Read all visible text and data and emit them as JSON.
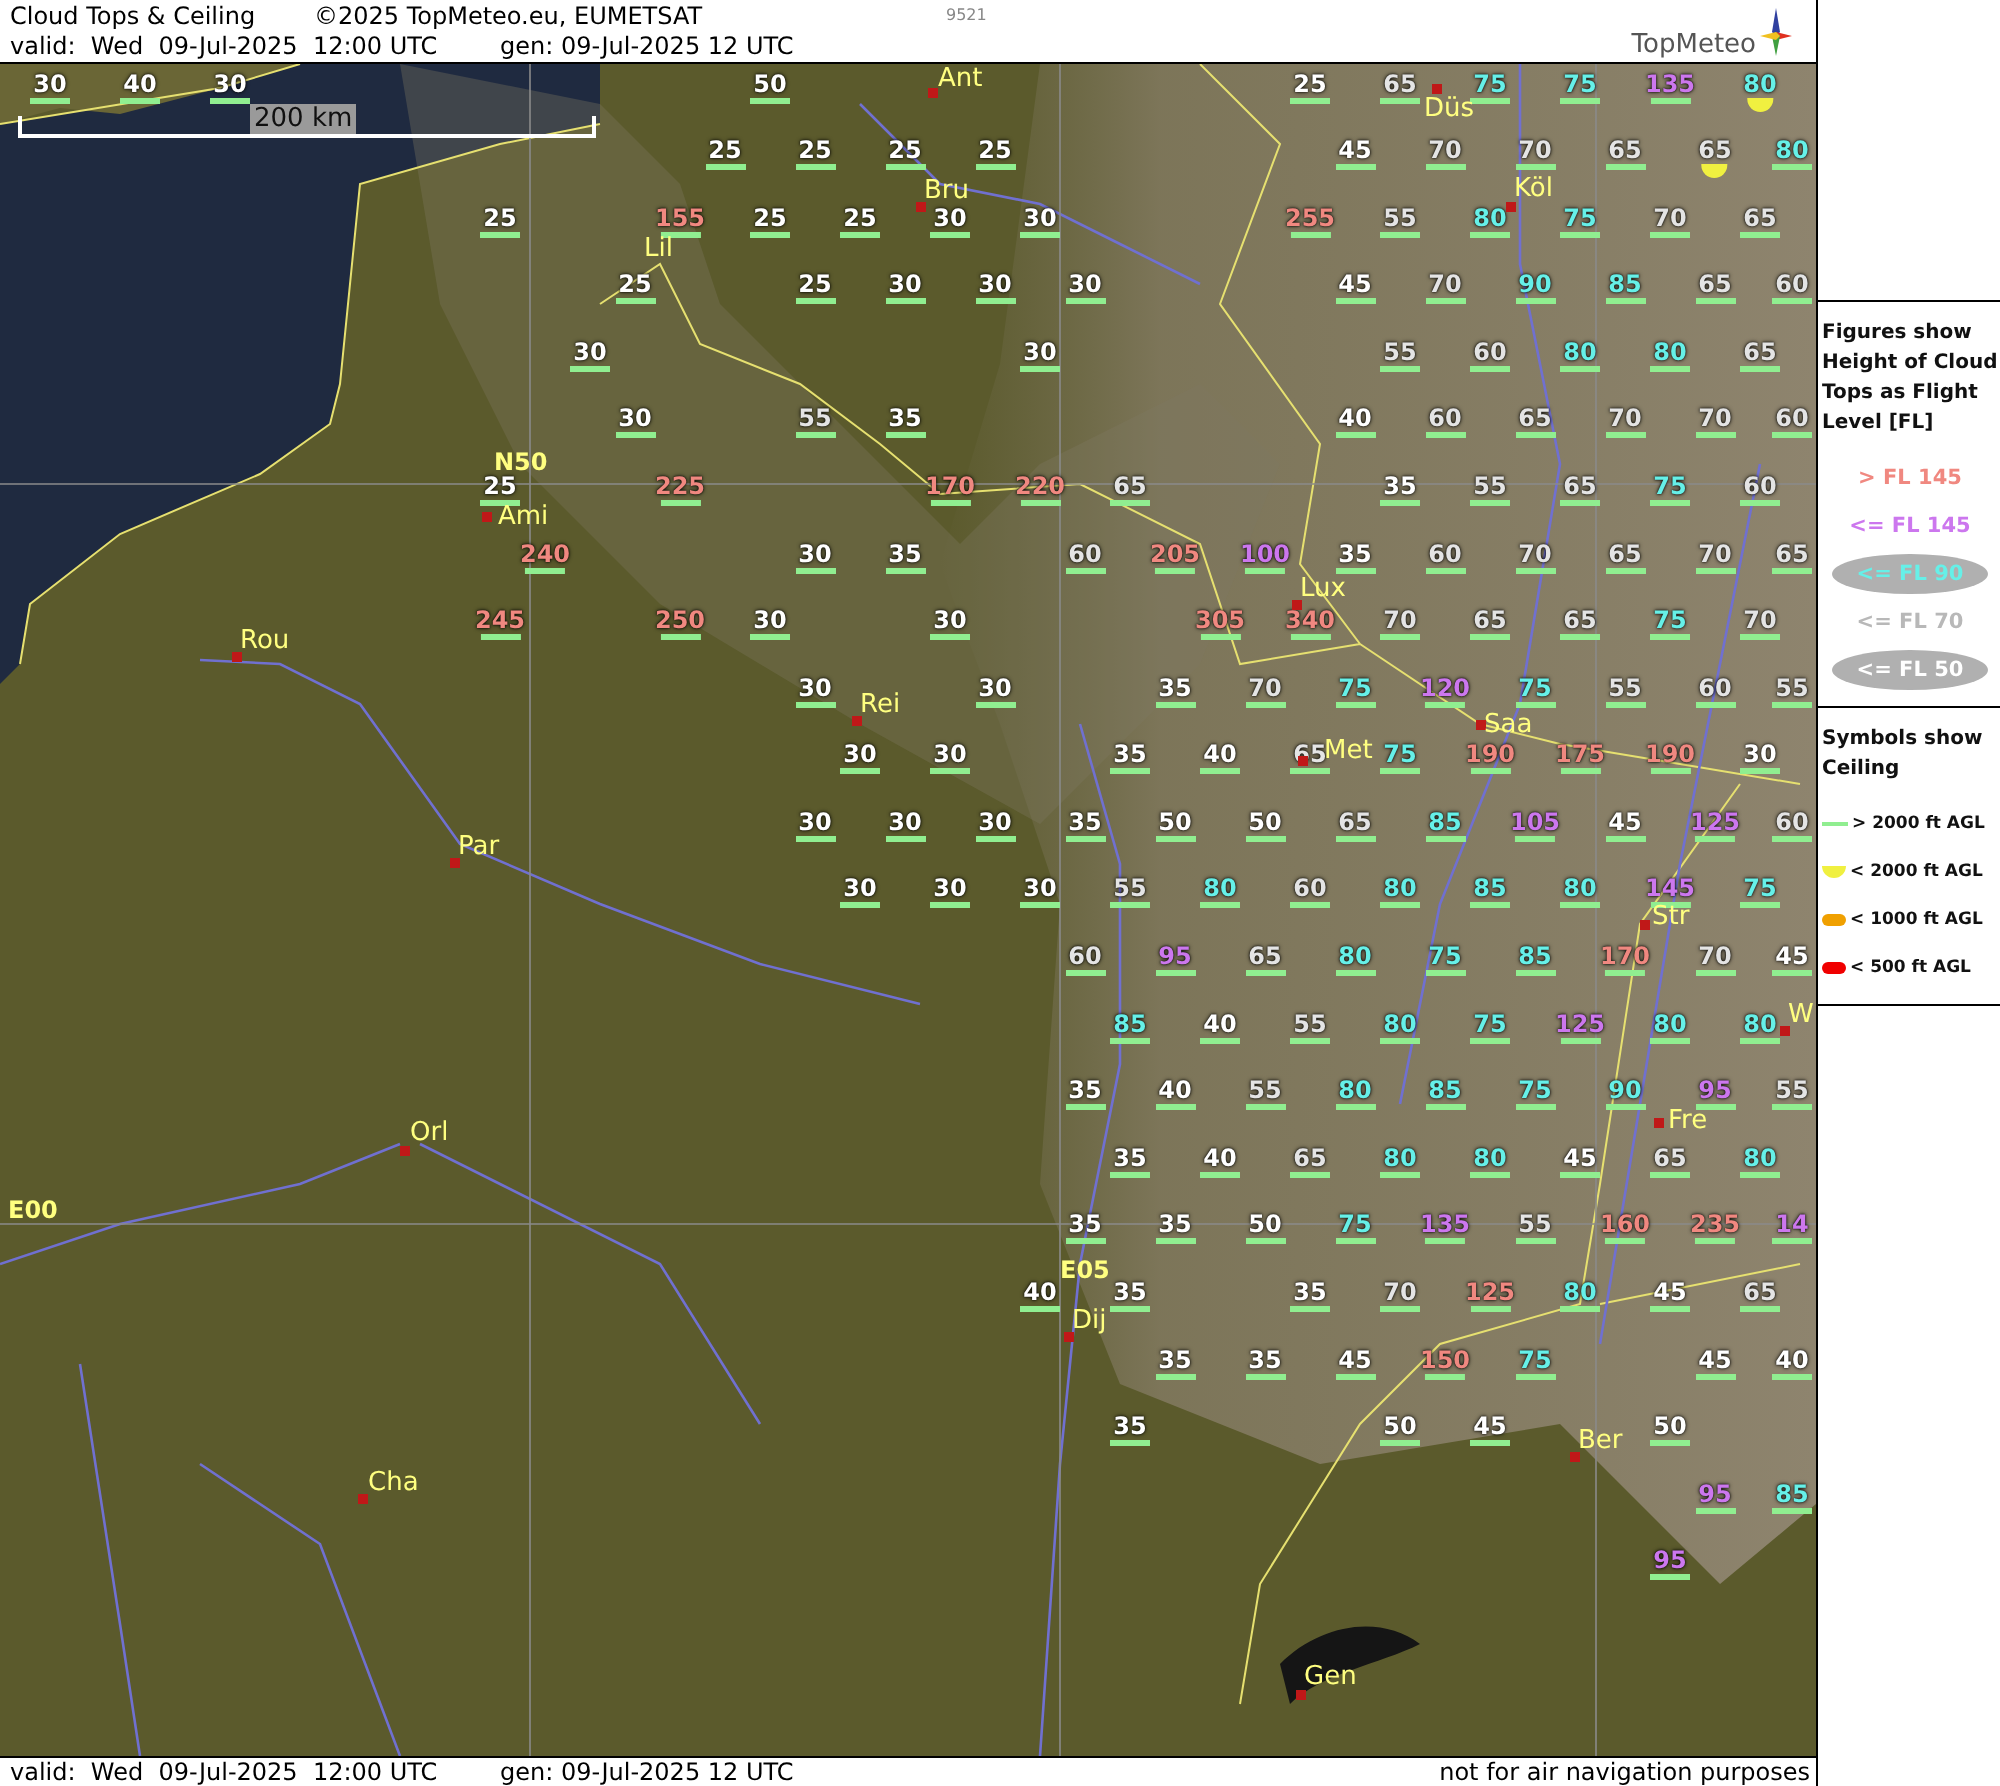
{
  "header": {
    "title": "Cloud Tops & Ceiling",
    "copyright": "©2025 TopMeteo.eu, EUMETSAT",
    "code": "9521",
    "valid": "valid:  Wed  09-Jul-2025  12:00 UTC",
    "generated": "gen: 09-Jul-2025 12 UTC",
    "logo": "TopMeteo"
  },
  "map": {
    "scale": "200 km",
    "grid_labels": [
      "N50",
      "E00",
      "E05"
    ],
    "cities": [
      {
        "name": "Düs",
        "marker": true
      },
      {
        "name": "Ant",
        "marker": true
      },
      {
        "name": "Bru",
        "marker": true
      },
      {
        "name": "Köl",
        "marker": true
      },
      {
        "name": "Lil",
        "marker": false
      },
      {
        "name": "Ami",
        "marker": true
      },
      {
        "name": "Lux",
        "marker": true
      },
      {
        "name": "Rou",
        "marker": true
      },
      {
        "name": "Rei",
        "marker": true
      },
      {
        "name": "Saa",
        "marker": true
      },
      {
        "name": "Met",
        "marker": true
      },
      {
        "name": "Par",
        "marker": true
      },
      {
        "name": "Str",
        "marker": true
      },
      {
        "name": "W",
        "marker": true
      },
      {
        "name": "Fre",
        "marker": true
      },
      {
        "name": "Orl",
        "marker": true
      },
      {
        "name": "Dij",
        "marker": true
      },
      {
        "name": "Ber",
        "marker": true
      },
      {
        "name": "Cha",
        "marker": true
      },
      {
        "name": "Gen",
        "marker": true
      }
    ],
    "rows": [
      {
        "cells": [
          {
            "value": "30",
            "color": "#ffffff",
            "low_ceiling": false
          },
          {
            "value": "40",
            "color": "#ffffff",
            "low_ceiling": false
          },
          {
            "value": "30",
            "color": "#ffffff",
            "low_ceiling": false
          },
          null,
          null,
          null,
          null,
          null,
          {
            "value": "50",
            "color": "#ffffff",
            "low_ceiling": false
          },
          null,
          null,
          null,
          null,
          null,
          {
            "value": "25",
            "color": "#ffffff",
            "low_ceiling": false
          },
          {
            "value": "65",
            "color": "#e4e4e4",
            "low_ceiling": false
          },
          {
            "value": "75",
            "color": "#66f0e8",
            "low_ceiling": false
          },
          {
            "value": "75",
            "color": "#66f0e8",
            "low_ceiling": false
          },
          {
            "value": "135",
            "color": "#cc77ee",
            "low_ceiling": false
          },
          {
            "value": "80",
            "color": "#66f0e8",
            "low_ceiling": true
          }
        ]
      },
      {
        "cells": [
          null,
          null,
          null,
          null,
          null,
          null,
          null,
          {
            "value": "25",
            "color": "#ffffff",
            "low_ceiling": false
          },
          {
            "value": "25",
            "color": "#ffffff",
            "low_ceiling": false
          },
          {
            "value": "25",
            "color": "#ffffff",
            "low_ceiling": false
          },
          {
            "value": "25",
            "color": "#ffffff",
            "low_ceiling": false
          },
          null,
          null,
          null,
          {
            "value": "45",
            "color": "#ffffff",
            "low_ceiling": false
          },
          {
            "value": "70",
            "color": "#e4e4e4",
            "low_ceiling": false
          },
          {
            "value": "70",
            "color": "#e4e4e4",
            "low_ceiling": false
          },
          {
            "value": "65",
            "color": "#e4e4e4",
            "low_ceiling": false
          },
          {
            "value": "65",
            "color": "#e4e4e4",
            "low_ceiling": true
          },
          {
            "value": "80",
            "color": "#66f0e8",
            "low_ceiling": false
          }
        ]
      },
      {
        "cells": [
          null,
          null,
          null,
          null,
          null,
          {
            "value": "25",
            "color": "#ffffff",
            "low_ceiling": false
          },
          null,
          {
            "value": "155",
            "color": "#f08880",
            "low_ceiling": false
          },
          {
            "value": "25",
            "color": "#ffffff",
            "low_ceiling": false
          },
          {
            "value": "25",
            "color": "#ffffff",
            "low_ceiling": false
          },
          {
            "value": "30",
            "color": "#ffffff",
            "low_ceiling": false
          },
          {
            "value": "30",
            "color": "#ffffff",
            "low_ceiling": false
          },
          null,
          null,
          {
            "value": "255",
            "color": "#f08880",
            "low_ceiling": false
          },
          {
            "value": "55",
            "color": "#e4e4e4",
            "low_ceiling": false
          },
          {
            "value": "80",
            "color": "#66f0e8",
            "low_ceiling": false
          },
          {
            "value": "75",
            "color": "#66f0e8",
            "low_ceiling": false
          },
          {
            "value": "70",
            "color": "#e4e4e4",
            "low_ceiling": false
          },
          {
            "value": "65",
            "color": "#e4e4e4",
            "low_ceiling": false
          }
        ]
      },
      {
        "cells": [
          null,
          null,
          null,
          null,
          null,
          null,
          {
            "value": "25",
            "color": "#ffffff",
            "low_ceiling": false
          },
          null,
          {
            "value": "25",
            "color": "#ffffff",
            "low_ceiling": false
          },
          {
            "value": "30",
            "color": "#ffffff",
            "low_ceiling": false
          },
          {
            "value": "30",
            "color": "#ffffff",
            "low_ceiling": false
          },
          {
            "value": "30",
            "color": "#ffffff",
            "low_ceiling": false
          },
          null,
          null,
          {
            "value": "45",
            "color": "#ffffff",
            "low_ceiling": false
          },
          {
            "value": "70",
            "color": "#e4e4e4",
            "low_ceiling": false
          },
          {
            "value": "90",
            "color": "#66f0e8",
            "low_ceiling": false
          },
          {
            "value": "85",
            "color": "#66f0e8",
            "low_ceiling": false
          },
          {
            "value": "65",
            "color": "#e4e4e4",
            "low_ceiling": false
          },
          {
            "value": "60",
            "color": "#e4e4e4",
            "low_ceiling": false
          }
        ]
      },
      {
        "cells": [
          null,
          null,
          null,
          null,
          null,
          null,
          {
            "value": "30",
            "color": "#ffffff",
            "low_ceiling": false
          },
          null,
          null,
          null,
          null,
          {
            "value": "30",
            "color": "#ffffff",
            "low_ceiling": false
          },
          null,
          null,
          null,
          {
            "value": "55",
            "color": "#e4e4e4",
            "low_ceiling": false
          },
          {
            "value": "60",
            "color": "#e4e4e4",
            "low_ceiling": false
          },
          {
            "value": "80",
            "color": "#66f0e8",
            "low_ceiling": false
          },
          {
            "value": "80",
            "color": "#66f0e8",
            "low_ceiling": false
          },
          {
            "value": "65",
            "color": "#e4e4e4",
            "low_ceiling": false
          }
        ]
      },
      {
        "cells": [
          null,
          null,
          null,
          null,
          null,
          null,
          {
            "value": "30",
            "color": "#ffffff",
            "low_ceiling": false
          },
          null,
          {
            "value": "55",
            "color": "#e4e4e4",
            "low_ceiling": false
          },
          {
            "value": "35",
            "color": "#ffffff",
            "low_ceiling": false
          },
          null,
          null,
          null,
          null,
          {
            "value": "40",
            "color": "#ffffff",
            "low_ceiling": false
          },
          {
            "value": "60",
            "color": "#e4e4e4",
            "low_ceiling": false
          },
          {
            "value": "65",
            "color": "#e4e4e4",
            "low_ceiling": false
          },
          {
            "value": "70",
            "color": "#e4e4e4",
            "low_ceiling": false
          },
          {
            "value": "70",
            "color": "#e4e4e4",
            "low_ceiling": false
          },
          {
            "value": "60",
            "color": "#e4e4e4",
            "low_ceiling": false
          }
        ]
      },
      {
        "cells": [
          null,
          null,
          null,
          null,
          null,
          {
            "value": "25",
            "color": "#ffffff",
            "low_ceiling": false
          },
          null,
          {
            "value": "225",
            "color": "#f08880",
            "low_ceiling": false
          },
          null,
          null,
          {
            "value": "170",
            "color": "#f08880",
            "low_ceiling": false
          },
          {
            "value": "220",
            "color": "#f08880",
            "low_ceiling": false
          },
          {
            "value": "65",
            "color": "#e4e4e4",
            "low_ceiling": false
          },
          null,
          null,
          {
            "value": "35",
            "color": "#ffffff",
            "low_ceiling": false
          },
          {
            "value": "55",
            "color": "#e4e4e4",
            "low_ceiling": false
          },
          {
            "value": "65",
            "color": "#e4e4e4",
            "low_ceiling": false
          },
          {
            "value": "75",
            "color": "#66f0e8",
            "low_ceiling": false
          },
          {
            "value": "60",
            "color": "#e4e4e4",
            "low_ceiling": false
          }
        ]
      },
      {
        "cells": [
          null,
          null,
          null,
          null,
          null,
          {
            "value": "240",
            "color": "#f08880",
            "low_ceiling": false
          },
          null,
          null,
          {
            "value": "30",
            "color": "#ffffff",
            "low_ceiling": false
          },
          {
            "value": "35",
            "color": "#ffffff",
            "low_ceiling": false
          },
          null,
          {
            "value": "60",
            "color": "#e4e4e4",
            "low_ceiling": false
          },
          {
            "value": "205",
            "color": "#f08880",
            "low_ceiling": false
          },
          {
            "value": "100",
            "color": "#cc77ee",
            "low_ceiling": false
          },
          {
            "value": "35",
            "color": "#ffffff",
            "low_ceiling": false
          },
          {
            "value": "60",
            "color": "#e4e4e4",
            "low_ceiling": false
          },
          {
            "value": "70",
            "color": "#e4e4e4",
            "low_ceiling": false
          },
          {
            "value": "65",
            "color": "#e4e4e4",
            "low_ceiling": false
          },
          {
            "value": "70",
            "color": "#e4e4e4",
            "low_ceiling": false
          },
          {
            "value": "65",
            "color": "#e4e4e4",
            "low_ceiling": false
          }
        ]
      },
      {
        "cells": [
          null,
          null,
          null,
          null,
          null,
          {
            "value": "245",
            "color": "#f08880",
            "low_ceiling": false
          },
          null,
          {
            "value": "250",
            "color": "#f08880",
            "low_ceiling": false
          },
          {
            "value": "30",
            "color": "#ffffff",
            "low_ceiling": false
          },
          null,
          {
            "value": "30",
            "color": "#ffffff",
            "low_ceiling": false
          },
          null,
          null,
          {
            "value": "305",
            "color": "#f08880",
            "low_ceiling": false
          },
          {
            "value": "340",
            "color": "#f08880",
            "low_ceiling": false
          },
          {
            "value": "70",
            "color": "#e4e4e4",
            "low_ceiling": false
          },
          {
            "value": "65",
            "color": "#e4e4e4",
            "low_ceiling": false
          },
          {
            "value": "65",
            "color": "#e4e4e4",
            "low_ceiling": false
          },
          {
            "value": "75",
            "color": "#66f0e8",
            "low_ceiling": false
          },
          {
            "value": "70",
            "color": "#e4e4e4",
            "low_ceiling": false
          }
        ]
      },
      {
        "cells": [
          null,
          null,
          null,
          null,
          null,
          null,
          null,
          null,
          {
            "value": "30",
            "color": "#ffffff",
            "low_ceiling": false
          },
          null,
          {
            "value": "30",
            "color": "#ffffff",
            "low_ceiling": false
          },
          null,
          {
            "value": "35",
            "color": "#ffffff",
            "low_ceiling": false
          },
          {
            "value": "70",
            "color": "#e4e4e4",
            "low_ceiling": false
          },
          {
            "value": "75",
            "color": "#66f0e8",
            "low_ceiling": false
          },
          {
            "value": "120",
            "color": "#cc77ee",
            "low_ceiling": false
          },
          {
            "value": "75",
            "color": "#66f0e8",
            "low_ceiling": false
          },
          {
            "value": "55",
            "color": "#e4e4e4",
            "low_ceiling": false
          },
          {
            "value": "60",
            "color": "#e4e4e4",
            "low_ceiling": false
          },
          {
            "value": "55",
            "color": "#e4e4e4",
            "low_ceiling": false
          }
        ]
      },
      {
        "cells": [
          null,
          null,
          null,
          null,
          null,
          null,
          null,
          null,
          null,
          {
            "value": "30",
            "color": "#ffffff",
            "low_ceiling": false
          },
          {
            "value": "30",
            "color": "#ffffff",
            "low_ceiling": false
          },
          null,
          {
            "value": "35",
            "color": "#ffffff",
            "low_ceiling": false
          },
          {
            "value": "40",
            "color": "#ffffff",
            "low_ceiling": false
          },
          {
            "value": "65",
            "color": "#e4e4e4",
            "low_ceiling": false
          },
          {
            "value": "75",
            "color": "#66f0e8",
            "low_ceiling": false
          },
          {
            "value": "190",
            "color": "#f08880",
            "low_ceiling": false
          },
          {
            "value": "175",
            "color": "#f08880",
            "low_ceiling": false
          },
          {
            "value": "190",
            "color": "#f08880",
            "low_ceiling": false
          },
          {
            "value": "30",
            "color": "#ffffff",
            "low_ceiling": false
          }
        ]
      },
      {
        "cells": [
          null,
          null,
          null,
          null,
          null,
          null,
          null,
          null,
          {
            "value": "30",
            "color": "#ffffff",
            "low_ceiling": false
          },
          {
            "value": "30",
            "color": "#ffffff",
            "low_ceiling": false
          },
          {
            "value": "30",
            "color": "#ffffff",
            "low_ceiling": false
          },
          {
            "value": "35",
            "color": "#ffffff",
            "low_ceiling": false
          },
          {
            "value": "50",
            "color": "#ffffff",
            "low_ceiling": false
          },
          {
            "value": "50",
            "color": "#ffffff",
            "low_ceiling": false
          },
          {
            "value": "65",
            "color": "#e4e4e4",
            "low_ceiling": false
          },
          {
            "value": "85",
            "color": "#66f0e8",
            "low_ceiling": false
          },
          {
            "value": "105",
            "color": "#cc77ee",
            "low_ceiling": false
          },
          {
            "value": "45",
            "color": "#ffffff",
            "low_ceiling": false
          },
          {
            "value": "125",
            "color": "#cc77ee",
            "low_ceiling": false
          },
          {
            "value": "60",
            "color": "#e4e4e4",
            "low_ceiling": false
          }
        ]
      },
      {
        "cells": [
          null,
          null,
          null,
          null,
          null,
          null,
          null,
          null,
          null,
          {
            "value": "30",
            "color": "#ffffff",
            "low_ceiling": false
          },
          {
            "value": "30",
            "color": "#ffffff",
            "low_ceiling": false
          },
          {
            "value": "30",
            "color": "#ffffff",
            "low_ceiling": false
          },
          {
            "value": "55",
            "color": "#e4e4e4",
            "low_ceiling": false
          },
          {
            "value": "80",
            "color": "#66f0e8",
            "low_ceiling": false
          },
          {
            "value": "60",
            "color": "#e4e4e4",
            "low_ceiling": false
          },
          {
            "value": "80",
            "color": "#66f0e8",
            "low_ceiling": false
          },
          {
            "value": "85",
            "color": "#66f0e8",
            "low_ceiling": false
          },
          {
            "value": "80",
            "color": "#66f0e8",
            "low_ceiling": false
          },
          {
            "value": "145",
            "color": "#cc77ee",
            "low_ceiling": false
          },
          {
            "value": "75",
            "color": "#66f0e8",
            "low_ceiling": false
          }
        ]
      },
      {
        "cells": [
          null,
          null,
          null,
          null,
          null,
          null,
          null,
          null,
          null,
          null,
          null,
          {
            "value": "60",
            "color": "#e4e4e4",
            "low_ceiling": false
          },
          {
            "value": "95",
            "color": "#cc77ee",
            "low_ceiling": false
          },
          {
            "value": "65",
            "color": "#e4e4e4",
            "low_ceiling": false
          },
          {
            "value": "80",
            "color": "#66f0e8",
            "low_ceiling": false
          },
          {
            "value": "75",
            "color": "#66f0e8",
            "low_ceiling": false
          },
          {
            "value": "85",
            "color": "#66f0e8",
            "low_ceiling": false
          },
          {
            "value": "170",
            "color": "#f08880",
            "low_ceiling": false
          },
          {
            "value": "70",
            "color": "#e4e4e4",
            "low_ceiling": false
          },
          {
            "value": "45",
            "color": "#ffffff",
            "low_ceiling": false
          }
        ]
      },
      {
        "cells": [
          null,
          null,
          null,
          null,
          null,
          null,
          null,
          null,
          null,
          null,
          null,
          null,
          {
            "value": "85",
            "color": "#66f0e8",
            "low_ceiling": false
          },
          {
            "value": "40",
            "color": "#ffffff",
            "low_ceiling": false
          },
          {
            "value": "55",
            "color": "#e4e4e4",
            "low_ceiling": false
          },
          {
            "value": "80",
            "color": "#66f0e8",
            "low_ceiling": false
          },
          {
            "value": "75",
            "color": "#66f0e8",
            "low_ceiling": false
          },
          {
            "value": "125",
            "color": "#cc77ee",
            "low_ceiling": false
          },
          {
            "value": "80",
            "color": "#66f0e8",
            "low_ceiling": false
          },
          {
            "value": "80",
            "color": "#66f0e8",
            "low_ceiling": false
          }
        ]
      },
      {
        "cells": [
          null,
          null,
          null,
          null,
          null,
          null,
          null,
          null,
          null,
          null,
          null,
          {
            "value": "35",
            "color": "#ffffff",
            "low_ceiling": false
          },
          {
            "value": "40",
            "color": "#ffffff",
            "low_ceiling": false
          },
          {
            "value": "55",
            "color": "#e4e4e4",
            "low_ceiling": false
          },
          {
            "value": "80",
            "color": "#66f0e8",
            "low_ceiling": false
          },
          {
            "value": "85",
            "color": "#66f0e8",
            "low_ceiling": false
          },
          {
            "value": "75",
            "color": "#66f0e8",
            "low_ceiling": false
          },
          {
            "value": "90",
            "color": "#66f0e8",
            "low_ceiling": false
          },
          {
            "value": "95",
            "color": "#cc77ee",
            "low_ceiling": false
          },
          {
            "value": "55",
            "color": "#e4e4e4",
            "low_ceiling": false
          }
        ]
      },
      {
        "cells": [
          null,
          null,
          null,
          null,
          null,
          null,
          null,
          null,
          null,
          null,
          null,
          null,
          {
            "value": "35",
            "color": "#ffffff",
            "low_ceiling": false
          },
          {
            "value": "40",
            "color": "#ffffff",
            "low_ceiling": false
          },
          {
            "value": "65",
            "color": "#e4e4e4",
            "low_ceiling": false
          },
          {
            "value": "80",
            "color": "#66f0e8",
            "low_ceiling": false
          },
          {
            "value": "80",
            "color": "#66f0e8",
            "low_ceiling": false
          },
          {
            "value": "45",
            "color": "#ffffff",
            "low_ceiling": false
          },
          {
            "value": "65",
            "color": "#e4e4e4",
            "low_ceiling": false
          },
          {
            "value": "80",
            "color": "#66f0e8",
            "low_ceiling": false
          }
        ]
      },
      {
        "cells": [
          null,
          null,
          null,
          null,
          null,
          null,
          null,
          null,
          null,
          null,
          null,
          {
            "value": "35",
            "color": "#ffffff",
            "low_ceiling": false
          },
          {
            "value": "35",
            "color": "#ffffff",
            "low_ceiling": false
          },
          {
            "value": "50",
            "color": "#ffffff",
            "low_ceiling": false
          },
          {
            "value": "75",
            "color": "#66f0e8",
            "low_ceiling": false
          },
          {
            "value": "135",
            "color": "#cc77ee",
            "low_ceiling": false
          },
          {
            "value": "55",
            "color": "#e4e4e4",
            "low_ceiling": false
          },
          {
            "value": "160",
            "color": "#f08880",
            "low_ceiling": false
          },
          {
            "value": "235",
            "color": "#f08880",
            "low_ceiling": false
          },
          {
            "value": "14",
            "color": "#cc77ee",
            "low_ceiling": false
          }
        ]
      },
      {
        "cells": [
          null,
          null,
          null,
          null,
          null,
          null,
          null,
          null,
          null,
          null,
          null,
          {
            "value": "40",
            "color": "#ffffff",
            "low_ceiling": false
          },
          {
            "value": "35",
            "color": "#ffffff",
            "low_ceiling": false
          },
          null,
          {
            "value": "35",
            "color": "#ffffff",
            "low_ceiling": false
          },
          {
            "value": "70",
            "color": "#e4e4e4",
            "low_ceiling": false
          },
          {
            "value": "125",
            "color": "#f08880",
            "low_ceiling": false
          },
          {
            "value": "80",
            "color": "#66f0e8",
            "low_ceiling": false
          },
          {
            "value": "45",
            "color": "#ffffff",
            "low_ceiling": false
          },
          {
            "value": "65",
            "color": "#e4e4e4",
            "low_ceiling": false
          }
        ]
      },
      {
        "cells": [
          null,
          null,
          null,
          null,
          null,
          null,
          null,
          null,
          null,
          null,
          null,
          null,
          {
            "value": "35",
            "color": "#ffffff",
            "low_ceiling": false
          },
          {
            "value": "35",
            "color": "#ffffff",
            "low_ceiling": false
          },
          {
            "value": "45",
            "color": "#ffffff",
            "low_ceiling": false
          },
          {
            "value": "150",
            "color": "#f08880",
            "low_ceiling": false
          },
          {
            "value": "75",
            "color": "#66f0e8",
            "low_ceiling": false
          },
          null,
          {
            "value": "45",
            "color": "#ffffff",
            "low_ceiling": false
          },
          {
            "value": "40",
            "color": "#ffffff",
            "low_ceiling": false
          }
        ]
      },
      {
        "cells": [
          null,
          null,
          null,
          null,
          null,
          null,
          null,
          null,
          null,
          null,
          null,
          null,
          {
            "value": "35",
            "color": "#ffffff",
            "low_ceiling": false
          },
          null,
          null,
          {
            "value": "50",
            "color": "#ffffff",
            "low_ceiling": false
          },
          {
            "value": "45",
            "color": "#ffffff",
            "low_ceiling": false
          },
          null,
          {
            "value": "50",
            "color": "#ffffff",
            "low_ceiling": false
          }
        ]
      },
      {
        "cells": [
          null,
          null,
          null,
          null,
          null,
          null,
          null,
          null,
          null,
          null,
          null,
          null,
          null,
          null,
          null,
          null,
          null,
          null,
          {
            "value": "95",
            "color": "#cc77ee",
            "low_ceiling": false
          },
          {
            "value": "85",
            "color": "#66f0e8",
            "low_ceiling": false
          }
        ]
      },
      {
        "cells": [
          null,
          null,
          null,
          null,
          null,
          null,
          null,
          null,
          null,
          null,
          null,
          null,
          null,
          null,
          null,
          null,
          null,
          null,
          {
            "value": "95",
            "color": "#cc77ee",
            "low_ceiling": false
          }
        ]
      }
    ]
  },
  "legend": {
    "figures_title": "Figures show Height of Cloud Tops as Flight Level  [FL]",
    "levels": [
      {
        "label": "> FL 145",
        "color": "#f08880",
        "kind": "plain"
      },
      {
        "label": "<= FL 145",
        "color": "#cc77ee",
        "kind": "plain"
      },
      {
        "label": "<= FL 90",
        "color": "#66f0e8",
        "kind": "ellipse"
      },
      {
        "label": "<= FL 70",
        "color": "#b8b8b8",
        "kind": "plain"
      },
      {
        "label": "<= FL 50",
        "color": "#ffffff",
        "kind": "ellipse"
      }
    ],
    "symbols_title": "Symbols show Ceiling",
    "symbols": [
      {
        "label": "> 2000 ft AGL",
        "kind": "line",
        "color": "#90ee90"
      },
      {
        "label": "< 2000 ft AGL",
        "kind": "half",
        "color": "#f0f040"
      },
      {
        "label": "< 1000 ft AGL",
        "kind": "pill",
        "color": "#f0a000"
      },
      {
        "label": "< 500 ft AGL",
        "kind": "pill",
        "color": "#f00000"
      }
    ]
  },
  "footer": {
    "valid": "valid:  Wed  09-Jul-2025  12:00 UTC",
    "generated": "gen: 09-Jul-2025 12 UTC",
    "disclaimer": "not for air navigation purposes"
  }
}
